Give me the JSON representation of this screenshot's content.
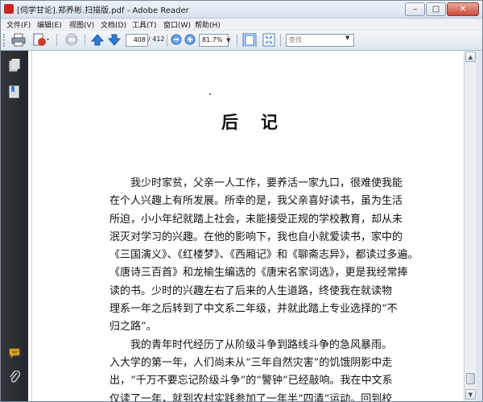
{
  "window": {
    "title": "[伺学甘论].郑养彬.扫描版.pdf - Adobe Reader",
    "buttons": {
      "minimize": "–",
      "maximize": "□",
      "close": "✕"
    }
  },
  "menu": [
    {
      "label": "文件(F)"
    },
    {
      "label": "编辑(E)"
    },
    {
      "label": "视图(V)"
    },
    {
      "label": "文档(D)"
    },
    {
      "label": "工具(T)"
    },
    {
      "label": "窗口(W)"
    },
    {
      "label": "帮助(H)"
    }
  ],
  "toolbar": {
    "page_current": "408",
    "page_total": "/ 412",
    "zoom": "81.7%",
    "search_placeholder": "查找"
  },
  "icons": {
    "print": "print-icon",
    "create_pdf": "create-pdf-icon",
    "email": "email-icon",
    "prev_page": "arrow-up-icon",
    "next_page": "arrow-down-icon",
    "zoom_out": "zoom-out-icon",
    "zoom_in": "zoom-in-icon",
    "fit_page": "fit-page-icon",
    "full_screen": "full-screen-icon",
    "pages_panel": "pages-icon",
    "bookmarks_panel": "bookmark-icon",
    "comments_panel": "comment-icon",
    "attachments_panel": "paperclip-icon"
  },
  "document": {
    "heading": "后记",
    "lines": [
      {
        "text": "我少时家贫，父亲一人工作，要养活一家九口，很难使我能",
        "indent": true
      },
      {
        "text": "在个人兴趣上有所发展。所幸的是，我父亲喜好读书，虽为生活",
        "indent": false
      },
      {
        "text": "所迫，小小年纪就踏上社会，未能接受正规的学校教育，却从未",
        "indent": false
      },
      {
        "text": "泯灭对学习的兴趣。在他的影响下，我也自小就爱读书，家中的",
        "indent": false
      },
      {
        "text": "《三国演义》、《红楼梦》、《西厢记》和《聊斋志异》，都读过多遍。",
        "indent": false
      },
      {
        "text": "《唐诗三百首》和龙榆生编选的《唐宋名家词选》，更是我经常捧",
        "indent": false
      },
      {
        "text": "读的书。少时的兴趣左右了后来的人生道路，终使我在就读物",
        "indent": false
      },
      {
        "text": "理系一年之后转到了中文系二年级，并就此踏上专业选择的“不",
        "indent": false
      },
      {
        "text": "归之路”。",
        "indent": false
      },
      {
        "text": "我的青年时代经历了从阶级斗争到路线斗争的急风暴雨。",
        "indent": true
      },
      {
        "text": "入大学的第一年，人们尚未从“三年自然灾害”的饥饿阴影中走",
        "indent": false
      },
      {
        "text": "出，“千万不要忘记阶级斗争”的“警钟”已经敲响。我在中文系",
        "indent": false
      },
      {
        "text": "仅读了一年，就到农村实践参加了一年半“四清”运动。回到校",
        "indent": false
      }
    ]
  },
  "colors": {
    "nav_pane": "#2b2f33",
    "window_frame": "#dfe6ee",
    "close_button": "#c9493a",
    "arrow_blue": "#2f79d3"
  }
}
